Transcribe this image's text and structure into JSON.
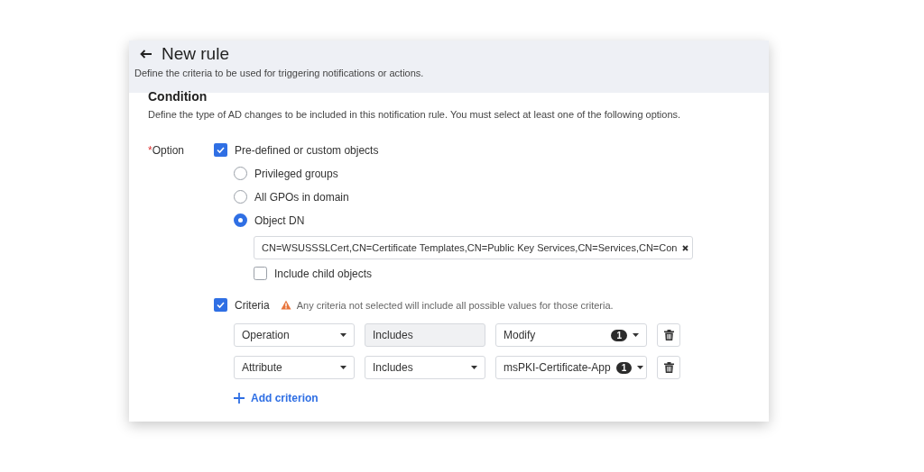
{
  "header": {
    "title": "New rule",
    "subtitle": "Define the criteria to be used for triggering notifications or actions."
  },
  "condition": {
    "title": "Condition",
    "description": "Define the type of AD changes to be included in this notification rule. You must select at least one of the following options."
  },
  "option": {
    "required_mark": "*",
    "label": "Option",
    "objects": {
      "label": "Pre-defined or custom objects",
      "checked": true
    },
    "choices": [
      {
        "label": "Privileged groups",
        "selected": false
      },
      {
        "label": "All GPOs in domain",
        "selected": false
      },
      {
        "label": "Object DN",
        "selected": true
      }
    ],
    "object_dn": "CN=WSUSSSLCert,CN=Certificate Templates,CN=Public Key Services,CN=Services,CN=Con",
    "include_child": {
      "label": "Include child objects",
      "checked": false
    }
  },
  "criteria": {
    "label": "Criteria",
    "checked": true,
    "warning": "Any criteria not selected will include all possible values for those criteria.",
    "rows": [
      {
        "field": "Operation",
        "operator": "Includes",
        "operator_disabled": true,
        "value": "Modify",
        "count": "1"
      },
      {
        "field": "Attribute",
        "operator": "Includes",
        "operator_disabled": false,
        "value": "msPKI-Certificate-App",
        "count": "1"
      }
    ],
    "add_button": "Add criterion"
  }
}
